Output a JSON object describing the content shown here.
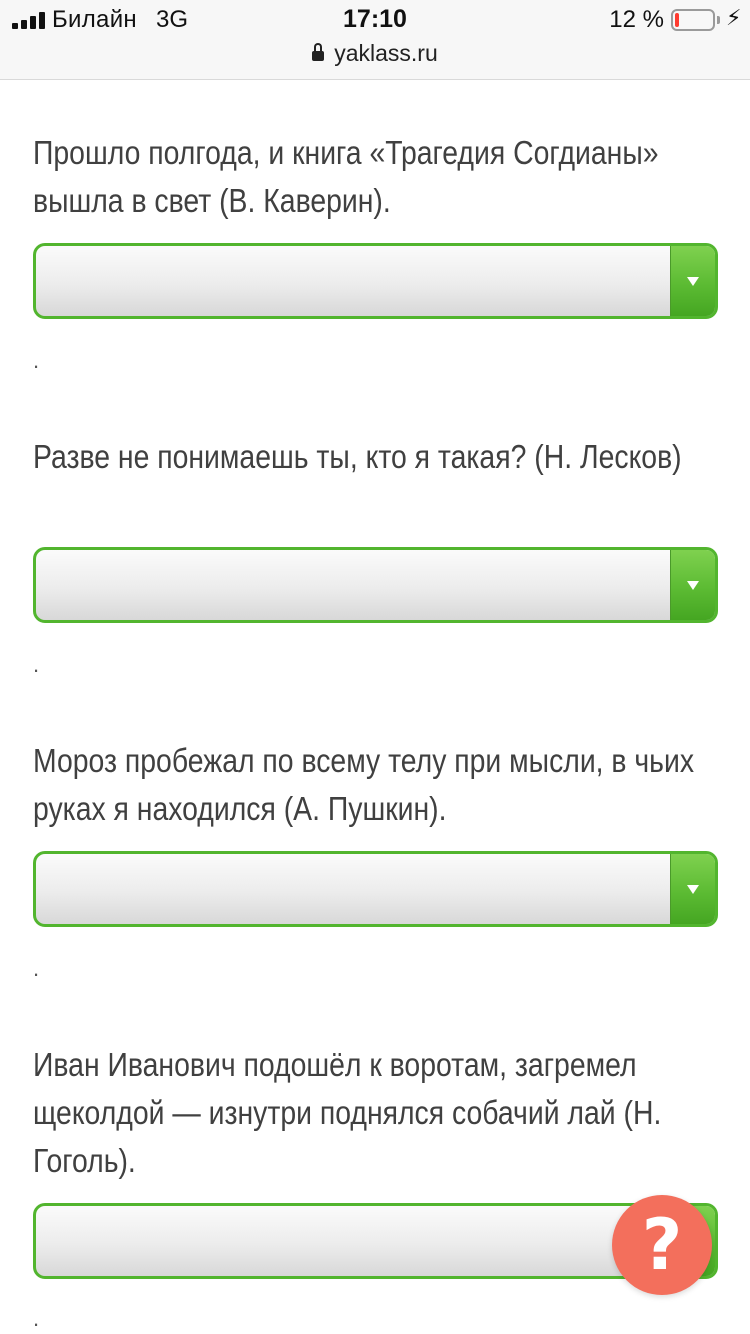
{
  "status_bar": {
    "carrier": "Билайн",
    "network": "3G",
    "time": "17:10",
    "battery_percent": "12 %",
    "battery_level": 0.12,
    "battery_color": "#ff3b30",
    "url": "yaklass.ru",
    "lock_icon": "lock-icon",
    "charging_icon": "bolt-icon"
  },
  "colors": {
    "select_border": "#52b52e",
    "help_button": "#f36f5c"
  },
  "questions": [
    {
      "text": "Прошло полгода, и книга «Трагедия Согдианы» вышла в свет (В. Каверин).",
      "selected": "",
      "trailing": "."
    },
    {
      "text": "Разве не понимаешь ты, кто я такая? (Н. Лесков)",
      "selected": "",
      "trailing": "."
    },
    {
      "text": "Мороз пробежал по всему телу при мысли, в чьих руках я находился (А. Пушкин).",
      "selected": "",
      "trailing": "."
    },
    {
      "text": "Иван Иванович подошёл к воротам, загремел щеколдой — изнутри поднялся собачий лай (Н. Гоголь).",
      "selected": "",
      "trailing": "."
    }
  ],
  "help_button": {
    "label": "?"
  }
}
